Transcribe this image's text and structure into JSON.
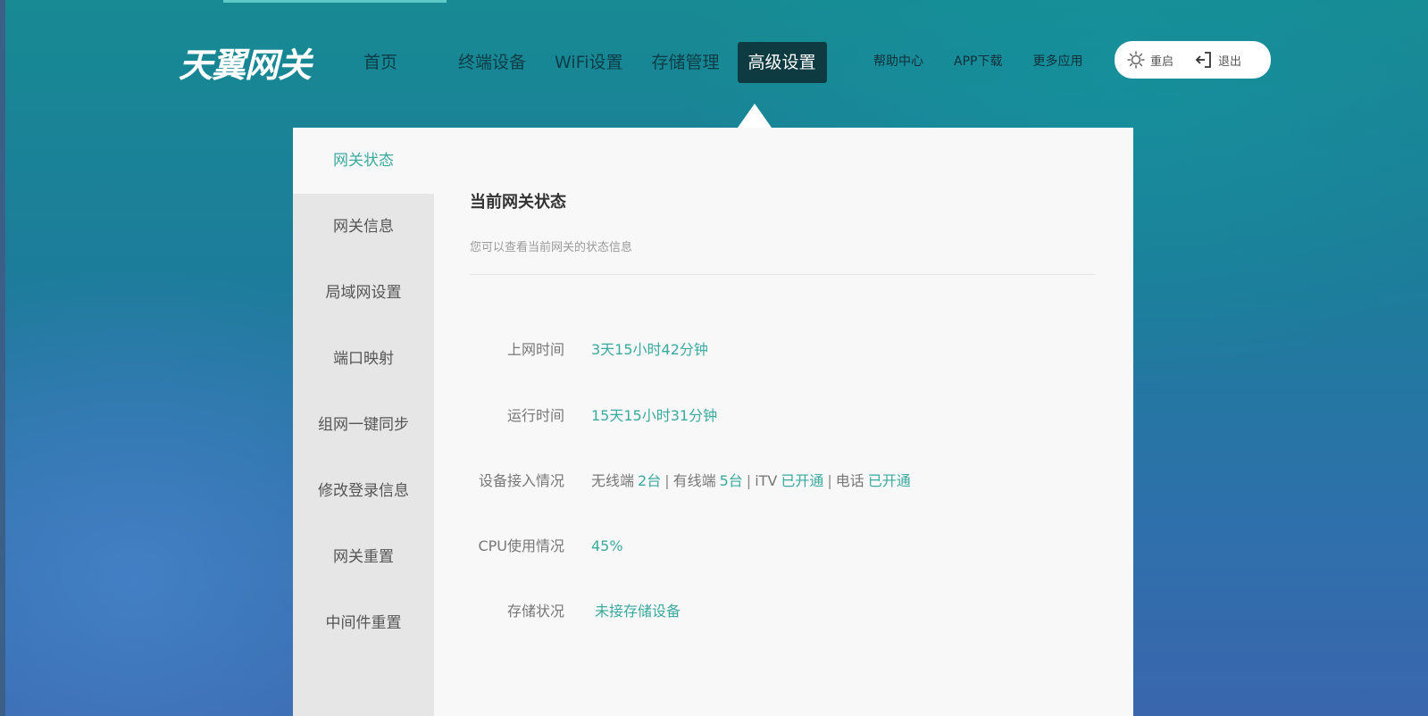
{
  "header": {
    "logo": "天翼网关",
    "nav": [
      {
        "label": "首页"
      },
      {
        "label": "终端设备"
      },
      {
        "label": "WiFi设置"
      },
      {
        "label": "存储管理"
      },
      {
        "label": "高级设置",
        "active": true
      }
    ],
    "links": [
      {
        "label": "帮助中心"
      },
      {
        "label": "APP下载"
      },
      {
        "label": "更多应用"
      }
    ],
    "actions": {
      "restart": {
        "label": "重启",
        "icon": "sun-icon"
      },
      "logout": {
        "label": "退出",
        "icon": "logout-icon"
      }
    }
  },
  "sidebar": {
    "items": [
      {
        "label": "网关状态",
        "active": true
      },
      {
        "label": "网关信息"
      },
      {
        "label": "局域网设置"
      },
      {
        "label": "端口映射"
      },
      {
        "label": "组网一键同步"
      },
      {
        "label": "修改登录信息"
      },
      {
        "label": "网关重置"
      },
      {
        "label": "中间件重置"
      }
    ]
  },
  "status": {
    "title": "当前网关状态",
    "subtitle": "您可以查看当前网关的状态信息",
    "online_time": {
      "label": "上网时间",
      "value": "3天15小时42分钟"
    },
    "run_time": {
      "label": "运行时间",
      "value": "15天15小时31分钟"
    },
    "devices": {
      "label": "设备接入情况",
      "wireless_label": "无线端",
      "wireless_value": "2台",
      "wired_label": "有线端",
      "wired_value": "5台",
      "itv_label": "iTV",
      "itv_value": "已开通",
      "phone_label": "电话",
      "phone_value": "已开通",
      "separator": "|"
    },
    "cpu": {
      "label": "CPU使用情况",
      "value": "45%"
    },
    "storage": {
      "label": "存储状况",
      "value": "未接存储设备"
    }
  },
  "colors": {
    "accent": "#3aa99e",
    "nav_active_bg": "#0e3a42"
  }
}
